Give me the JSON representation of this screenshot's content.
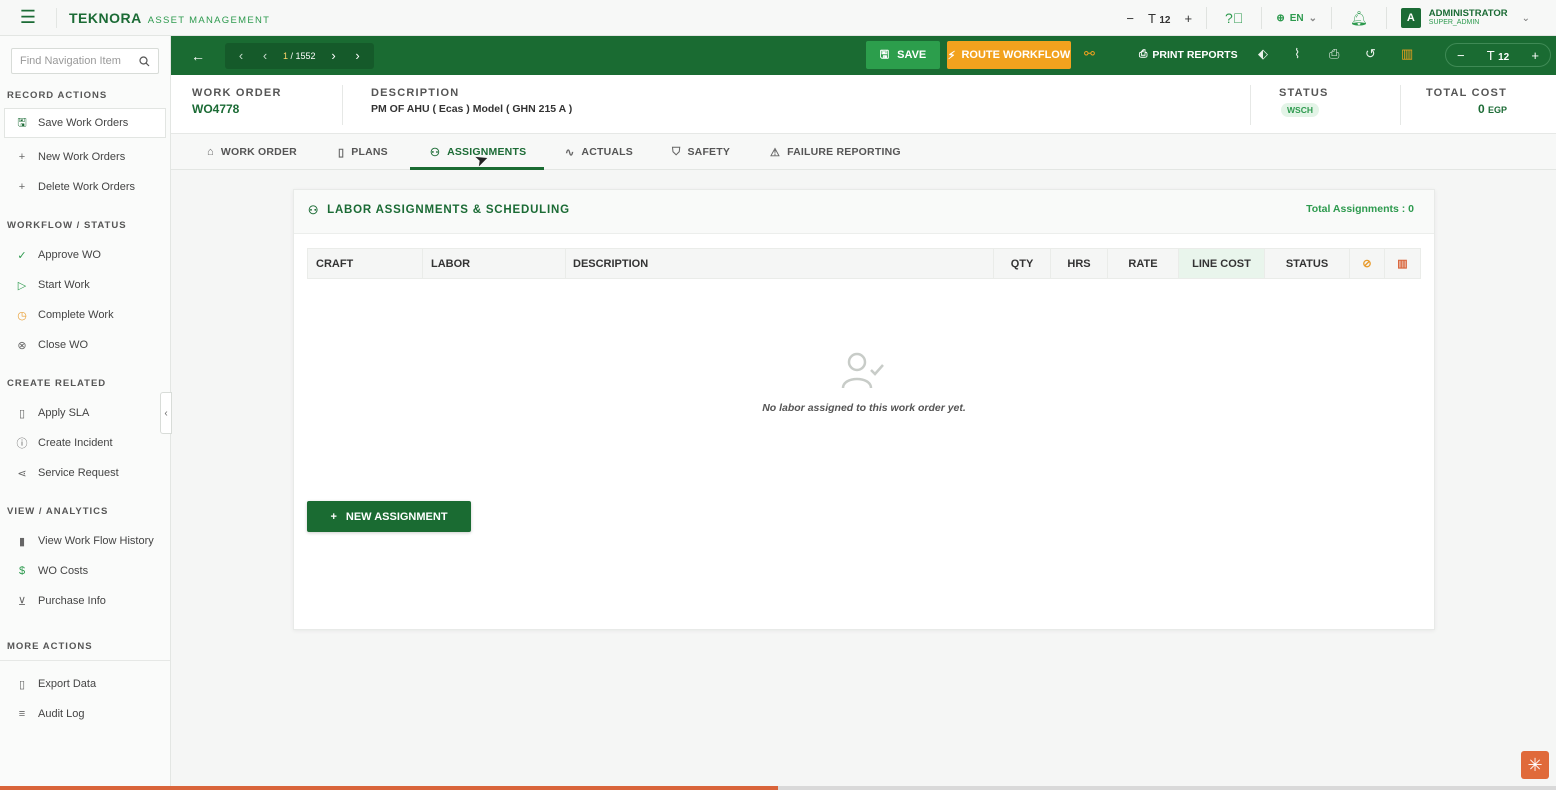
{
  "topbar": {
    "brand_logo": "TEKNORA",
    "brand_sub": "ASSET MANAGEMENT",
    "font_size_value": "12",
    "language": "EN",
    "user_initial": "A",
    "user_name": "ADMINISTRATOR",
    "user_role": "SUPER_ADMIN"
  },
  "sidebar": {
    "search_placeholder": "Find Navigation Item",
    "sections": {
      "record_actions": "RECORD ACTIONS",
      "workflow": "WORKFLOW / STATUS",
      "create_related": "CREATE RELATED",
      "view_analytics": "VIEW / ANALYTICS",
      "more_actions": "MORE ACTIONS"
    },
    "items": {
      "save": "Save Work Orders",
      "new": "New Work Orders",
      "delete": "Delete Work Orders",
      "approve": "Approve WO",
      "start": "Start Work",
      "complete": "Complete Work",
      "close": "Close WO",
      "sla": "Apply SLA",
      "incident": "Create Incident",
      "service": "Service Request",
      "history": "View Work Flow History",
      "costs": "WO Costs",
      "purchase": "Purchase Info",
      "export": "Export Data",
      "audit": "Audit Log"
    }
  },
  "toolbar": {
    "record_index": "1",
    "record_total": "/ 1552",
    "save_label": "SAVE",
    "route_label": "ROUTE WORKFLOW",
    "print_label": "PRINT REPORTS",
    "font_size_value": "12"
  },
  "record": {
    "wo_label": "WORK ORDER",
    "wo_value": "WO4778",
    "desc_label": "DESCRIPTION",
    "desc_value": "PM OF AHU   ( Ecas ) Model ( GHN 215 A )",
    "status_label": "STATUS",
    "status_value": "WSCH",
    "cost_label": "TOTAL COST",
    "cost_value": "0",
    "cost_currency": "EGP"
  },
  "tabs": {
    "work_order": "WORK ORDER",
    "plans": "PLANS",
    "assignments": "ASSIGNMENTS",
    "actuals": "ACTUALS",
    "safety": "SAFETY",
    "failure": "FAILURE REPORTING"
  },
  "card": {
    "title": "LABOR ASSIGNMENTS & SCHEDULING",
    "count": "Total Assignments : 0",
    "columns": {
      "craft": "CRAFT",
      "labor": "LABOR",
      "description": "DESCRIPTION",
      "qty": "QTY",
      "hrs": "HRS",
      "rate": "RATE",
      "line_cost": "LINE COST",
      "status": "STATUS"
    },
    "empty_text": "No labor assigned to this work order yet.",
    "new_button": "NEW ASSIGNMENT"
  },
  "progress": {
    "fraction": 0.5
  },
  "colors": {
    "brand_green": "#1a6b32",
    "accent_orange": "#f2a21e",
    "light_green": "#2d9a4e"
  }
}
